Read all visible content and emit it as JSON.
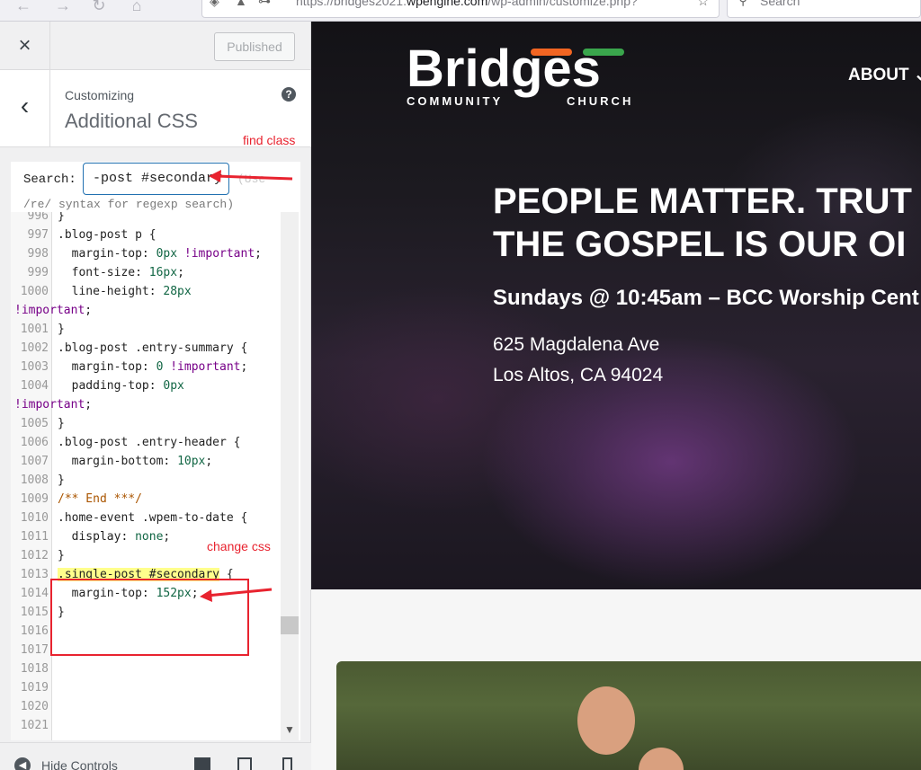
{
  "browser": {
    "url_prefix": "https://bridges2021.",
    "url_host": "wpengine.com",
    "url_path": "/wp-admin/customize.php?",
    "search_placeholder": "Search"
  },
  "customizer": {
    "close_label": "×",
    "published_label": "Published",
    "back_label": "‹",
    "customizing_label": "Customizing",
    "section_title": "Additional CSS",
    "help_label": "?",
    "search_label": "Search:",
    "search_value": "-post #secondary",
    "search_hint_1": "(Use",
    "search_hint_2": "/re/ syntax for regexp search)",
    "hide_controls_label": "Hide Controls"
  },
  "annotations": {
    "find_class": "find class",
    "change_css": "change css"
  },
  "code": {
    "lines": [
      {
        "n": "996",
        "text": "}"
      },
      {
        "n": "997",
        "text": ".blog-post p {"
      },
      {
        "n": "998",
        "text": "  margin-top: 0px !important;"
      },
      {
        "n": "999",
        "text": "  font-size: 16px;"
      },
      {
        "n": "1000",
        "text": "  line-height: 28px"
      },
      {
        "n": "",
        "text": "!important;"
      },
      {
        "n": "1001",
        "text": "}"
      },
      {
        "n": "1002",
        "text": ".blog-post .entry-summary {"
      },
      {
        "n": "1003",
        "text": "  margin-top: 0 !important;"
      },
      {
        "n": "1004",
        "text": "  padding-top: 0px"
      },
      {
        "n": "",
        "text": "!important;"
      },
      {
        "n": "1005",
        "text": "}"
      },
      {
        "n": "1006",
        "text": ".blog-post .entry-header {"
      },
      {
        "n": "1007",
        "text": "  margin-bottom: 10px;"
      },
      {
        "n": "1008",
        "text": "}"
      },
      {
        "n": "1009",
        "text": "/** End ***/"
      },
      {
        "n": "1010",
        "text": ".home-event .wpem-to-date {"
      },
      {
        "n": "1011",
        "text": "  display: none;"
      },
      {
        "n": "1012",
        "text": "}"
      },
      {
        "n": "1013",
        "text": ".single-post #secondary {"
      },
      {
        "n": "1014",
        "text": "  margin-top: 152px;"
      },
      {
        "n": "1015",
        "text": "}"
      },
      {
        "n": "1016",
        "text": ""
      },
      {
        "n": "1017",
        "text": ""
      },
      {
        "n": "1018",
        "text": ""
      },
      {
        "n": "1019",
        "text": ""
      },
      {
        "n": "1020",
        "text": ""
      },
      {
        "n": "1021",
        "text": ""
      }
    ]
  },
  "preview": {
    "logo_word": "Bridges",
    "logo_sub_left": "COMMUNITY",
    "logo_sub_right": "CHURCH",
    "nav_about": "ABOUT ⌄",
    "headline_1": "PEOPLE MATTER. TRUT",
    "headline_2": "THE GOSPEL IS OUR OI",
    "service_time": "Sundays @ 10:45am – BCC Worship Cent",
    "address_1": "625 Magdalena Ave",
    "address_2": "Los Altos, CA 94024"
  },
  "colors": {
    "annotation_red": "#e8232f",
    "wp_blue": "#2271b1",
    "match_highlight": "#ffff8c",
    "logo_orange": "#f26522",
    "logo_green": "#3aa64c"
  }
}
